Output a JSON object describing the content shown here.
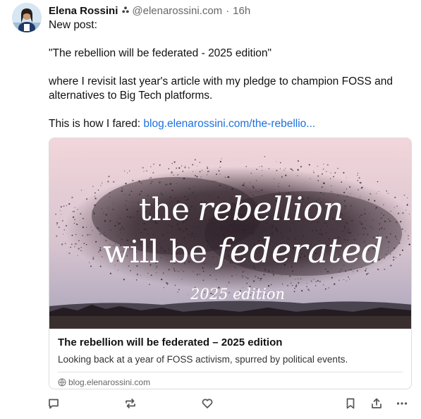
{
  "post": {
    "author": {
      "display_name": "Elena Rossini",
      "handle": "@elenarossini.com",
      "bot_icon": "dots-cluster-icon"
    },
    "separator": "·",
    "time": "16h",
    "content": {
      "line1": "New post:",
      "line2": "\"The rebellion will be federated - 2025 edition\"",
      "line3": "where I revisit last year's article with my pledge to champion FOSS and alternatives to Big Tech platforms.",
      "line4_prefix": "This is how I fared: ",
      "link_text": "blog.elenarossini.com/the-rebellio..."
    },
    "card": {
      "image_text": {
        "line1_plain": "the",
        "line1_script": "rebellion",
        "line2_plain": "will be",
        "line2_script": "federated",
        "line3": "2025 edition"
      },
      "title": "The rebellion will be federated – 2025 edition",
      "description": "Looking back at a year of FOSS activism, spurred by political events.",
      "domain": "blog.elenarossini.com"
    },
    "actions": [
      "reply-icon",
      "boost-icon",
      "favourite-icon",
      "bookmark-icon",
      "share-icon",
      "more-icon"
    ]
  },
  "colors": {
    "link": "#1d6fdc",
    "secondary_text": "#666666",
    "sky_top": "#f1d3d8",
    "sky_bottom": "#a7a3b8"
  }
}
